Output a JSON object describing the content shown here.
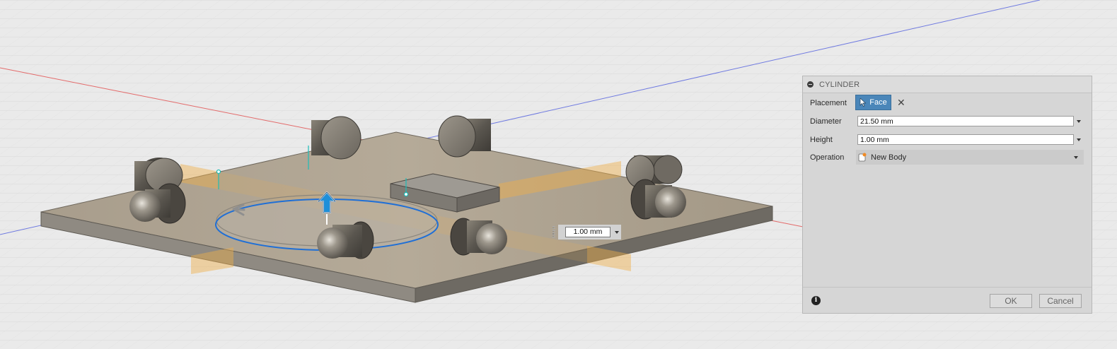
{
  "dialog": {
    "title": "CYLINDER",
    "placement": {
      "label": "Placement",
      "button": "Face"
    },
    "diameter": {
      "label": "Diameter",
      "value": "21.50 mm"
    },
    "height": {
      "label": "Height",
      "value": "1.00 mm"
    },
    "operation": {
      "label": "Operation",
      "value": "New Body"
    },
    "ok": "OK",
    "cancel": "Cancel"
  },
  "canvas": {
    "height_input": "1.00 mm",
    "icons": [
      "arrow-up-manipulator-icon",
      "rotate-arrow-icon",
      "info-icon",
      "cursor-icon",
      "close-icon"
    ]
  },
  "colors": {
    "accent_blue": "#4a86b9",
    "selection_blue": "#1f6fd6",
    "plane_orange": "#f0b04a",
    "background": "#e9e9e9"
  }
}
